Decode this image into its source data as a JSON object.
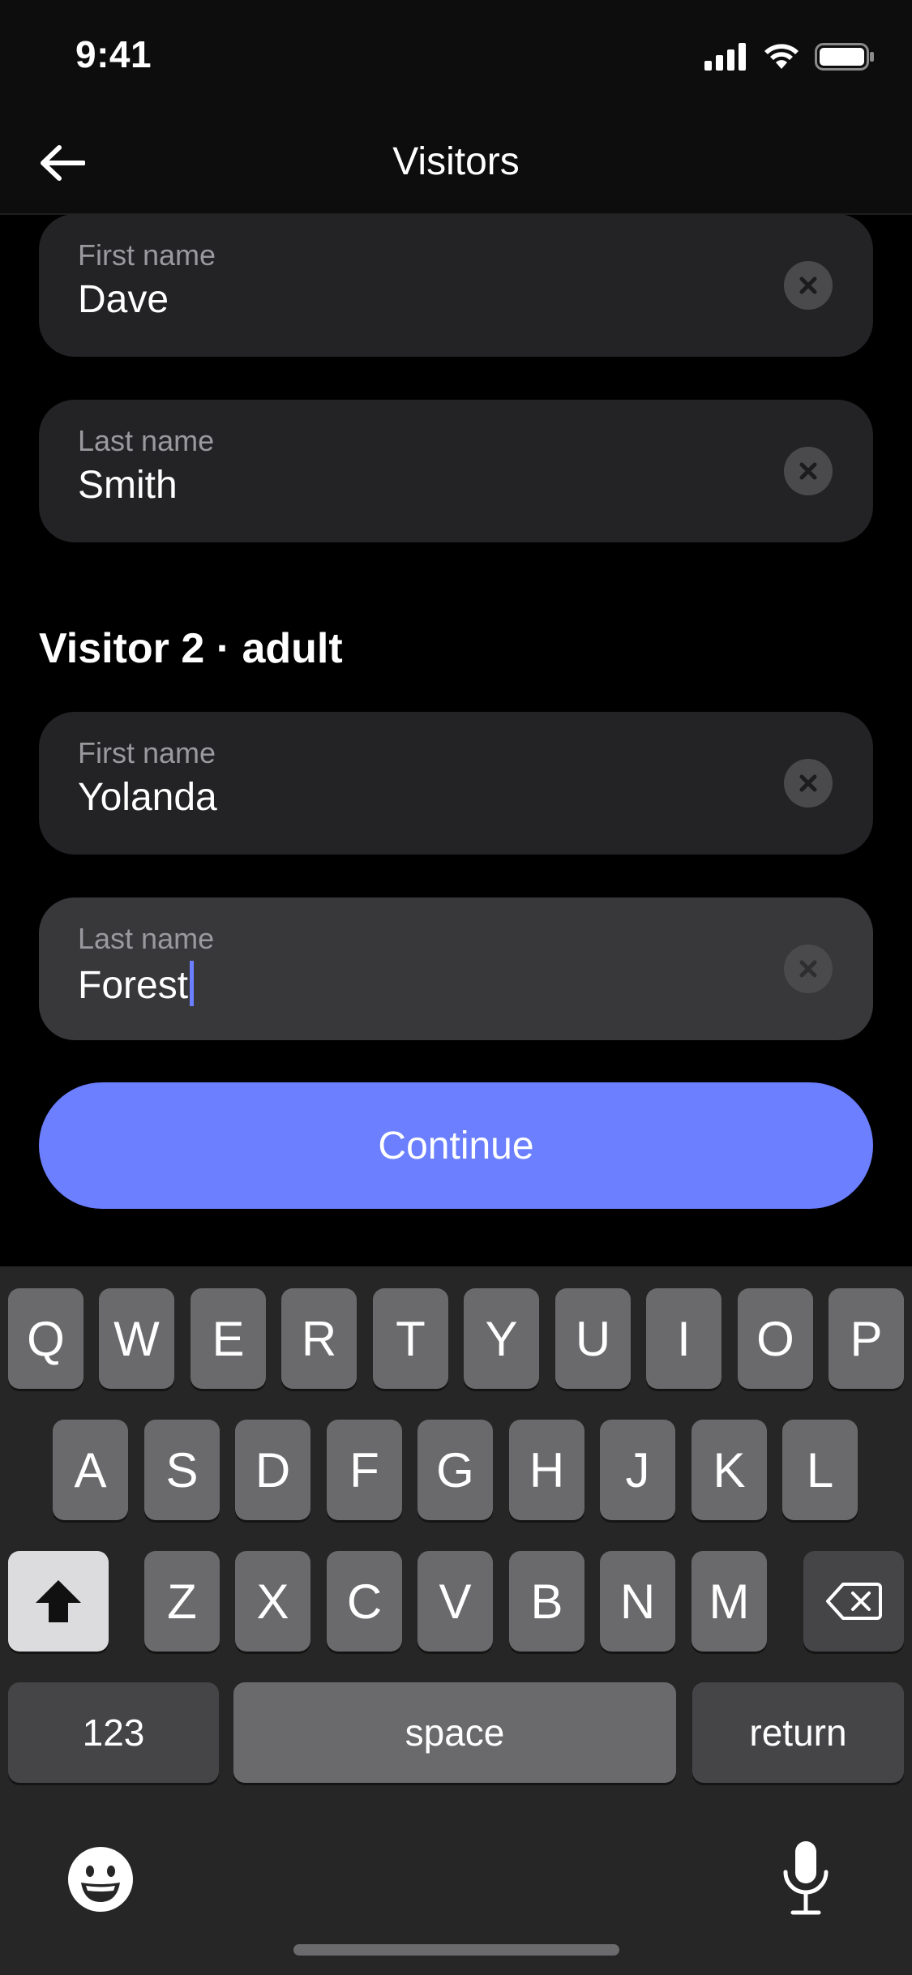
{
  "status_bar": {
    "time": "9:41"
  },
  "nav": {
    "title": "Visitors"
  },
  "visitor1": {
    "first_name": {
      "label": "First name",
      "value": "Dave"
    },
    "last_name": {
      "label": "Last name",
      "value": "Smith"
    }
  },
  "visitor2": {
    "heading": "Visitor 2 · adult",
    "first_name": {
      "label": "First name",
      "value": "Yolanda"
    },
    "last_name": {
      "label": "Last name",
      "value": "Forest"
    }
  },
  "continue_label": "Continue",
  "keyboard": {
    "row1": [
      "Q",
      "W",
      "E",
      "R",
      "T",
      "Y",
      "U",
      "I",
      "O",
      "P"
    ],
    "row2": [
      "A",
      "S",
      "D",
      "F",
      "G",
      "H",
      "J",
      "K",
      "L"
    ],
    "row3": [
      "Z",
      "X",
      "C",
      "V",
      "B",
      "N",
      "M"
    ],
    "numbers_label": "123",
    "space_label": "space",
    "return_label": "return"
  },
  "colors": {
    "accent": "#6b7fff",
    "field_bg": "#232325",
    "field_active_bg": "#38383b"
  }
}
